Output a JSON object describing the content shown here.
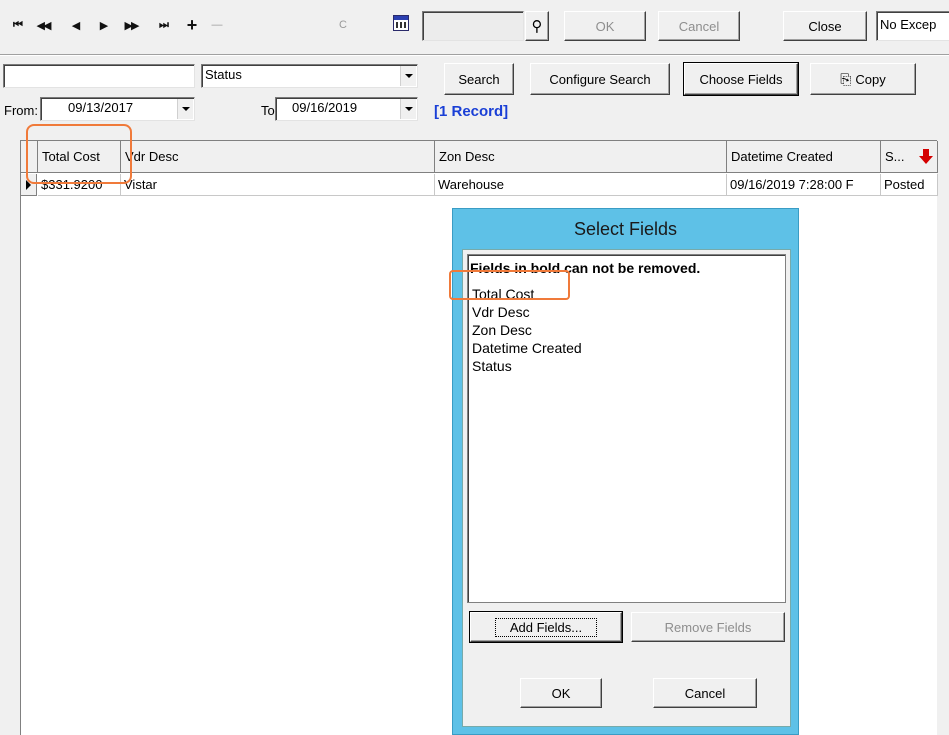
{
  "toolbar": {
    "first": "⏮",
    "prev_page": "◀◀",
    "prev": "◀",
    "next": "▶",
    "next_page": "▶▶",
    "last": "⏭",
    "add": "+",
    "remove": "—",
    "c_label": "C",
    "ok_label": "OK",
    "cancel_label": "Cancel",
    "close_label": "Close",
    "exception_value": "No Excep"
  },
  "search": {
    "text_value": "",
    "field_select": "Status",
    "search_label": "Search",
    "configure_label": "Configure Search",
    "choose_fields_label": "Choose Fields",
    "copy_label": "Copy",
    "from_label": "From:",
    "from_date": "09/13/2017",
    "to_label": "To:",
    "to_date": "09/16/2019",
    "record_count": "[1 Record]"
  },
  "grid": {
    "columns": [
      "Total Cost",
      "Vdr Desc",
      "Zon Desc",
      "Datetime Created",
      "S..."
    ],
    "rows": [
      [
        "$331.9200",
        "Vistar",
        "Warehouse",
        "09/16/2019 7:28:00 F",
        "Posted"
      ]
    ]
  },
  "dialog": {
    "title": "Select Fields",
    "note": "Fields in bold can not be removed.",
    "fields": [
      "Total Cost",
      "Vdr Desc",
      "Zon Desc",
      "Datetime Created",
      "Status"
    ],
    "add_label": "Add Fields...",
    "remove_label": "Remove Fields",
    "ok_label": "OK",
    "cancel_label": "Cancel"
  },
  "colors": {
    "highlight": "#f07a3a",
    "dialog_frame": "#5ec1e7",
    "record_count": "#1a3fd6"
  }
}
